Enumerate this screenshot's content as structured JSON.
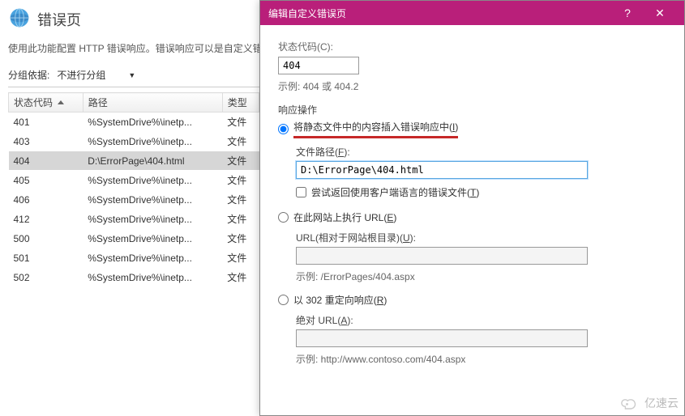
{
  "page": {
    "title": "错误页",
    "desc": "使用此功能配置 HTTP 错误响应。错误响应可以是自定义错误",
    "group_label": "分组依据:",
    "group_value": "不进行分组"
  },
  "columns": {
    "status": "状态代码",
    "path": "路径",
    "type": "类型"
  },
  "rows": [
    {
      "code": "401",
      "path": "%SystemDrive%\\inetp...",
      "type": "文件",
      "sel": false
    },
    {
      "code": "403",
      "path": "%SystemDrive%\\inetp...",
      "type": "文件",
      "sel": false
    },
    {
      "code": "404",
      "path": "D:\\ErrorPage\\404.html",
      "type": "文件",
      "sel": true
    },
    {
      "code": "405",
      "path": "%SystemDrive%\\inetp...",
      "type": "文件",
      "sel": false
    },
    {
      "code": "406",
      "path": "%SystemDrive%\\inetp...",
      "type": "文件",
      "sel": false
    },
    {
      "code": "412",
      "path": "%SystemDrive%\\inetp...",
      "type": "文件",
      "sel": false
    },
    {
      "code": "500",
      "path": "%SystemDrive%\\inetp...",
      "type": "文件",
      "sel": false
    },
    {
      "code": "501",
      "path": "%SystemDrive%\\inetp...",
      "type": "文件",
      "sel": false
    },
    {
      "code": "502",
      "path": "%SystemDrive%\\inetp...",
      "type": "文件",
      "sel": false
    }
  ],
  "dialog": {
    "title": "编辑自定义错误页",
    "status_label": "状态代码(C):",
    "status_value": "404",
    "status_example": "示例: 404 或 404.2",
    "response_label": "响应操作",
    "opt_static_prefix": "将静态文件中的内容插入错误响应中(",
    "opt_static_key": "I",
    "opt_static_suffix": ")",
    "file_path_label_prefix": "文件路径(",
    "file_path_key": "F",
    "file_path_label_suffix": "):",
    "file_path_value": "D:\\ErrorPage\\404.html",
    "chk_client_lang_prefix": "尝试返回使用客户端语言的错误文件(",
    "chk_client_lang_key": "T",
    "chk_client_lang_suffix": ")",
    "opt_execute_url_prefix": "在此网站上执行 URL(",
    "opt_execute_url_key": "E",
    "opt_execute_url_suffix": ")",
    "url_rel_label_prefix": "URL(相对于网站根目录)(",
    "url_rel_key": "U",
    "url_rel_label_suffix": "):",
    "url_rel_value": "",
    "url_rel_example": "示例: /ErrorPages/404.aspx",
    "opt_redirect_prefix": "以 302 重定向响应(",
    "opt_redirect_key": "R",
    "opt_redirect_suffix": ")",
    "abs_url_label_prefix": "绝对 URL(",
    "abs_url_key": "A",
    "abs_url_label_suffix": "):",
    "abs_url_value": "",
    "abs_url_example": "示例: http://www.contoso.com/404.aspx"
  },
  "watermark": "亿速云"
}
